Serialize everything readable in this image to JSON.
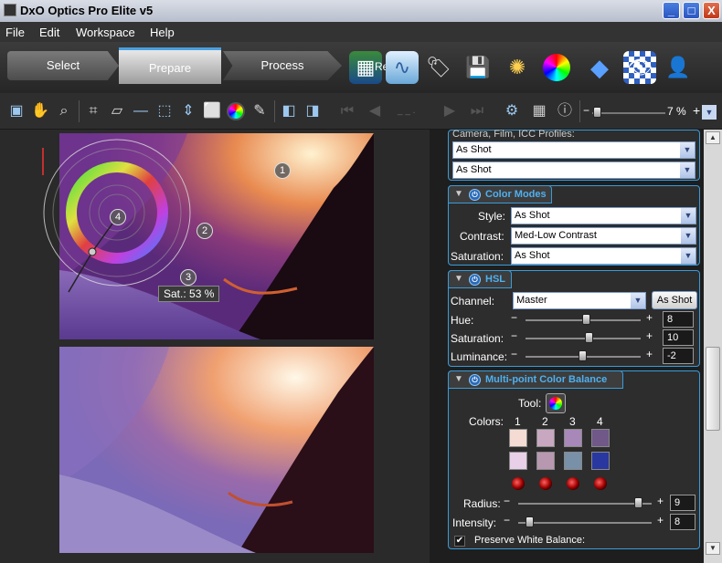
{
  "window": {
    "title": "DxO Optics Pro Elite v5",
    "minimize": "_",
    "maximize": "□",
    "close": "X"
  },
  "menu": [
    "File",
    "Edit",
    "Workspace",
    "Help"
  ],
  "tabs": {
    "select": "Select",
    "prepare": "Prepare",
    "process": "Process",
    "read_frag": "Re"
  },
  "toolbar": {
    "zoom": "7 %",
    "pager": "_ _ ."
  },
  "image": {
    "markers": [
      "1",
      "2",
      "3",
      "4"
    ],
    "sat_readout": "Sat.: 53 %"
  },
  "panel": {
    "profiles_label": "Camera, Film, ICC Profiles:",
    "profiles": [
      "As Shot",
      "As Shot"
    ],
    "color_modes": {
      "title": "Color Modes",
      "style_label": "Style:",
      "style": "As Shot",
      "contrast_label": "Contrast:",
      "contrast": "Med-Low Contrast",
      "saturation_label": "Saturation:",
      "saturation": "As Shot"
    },
    "hsl": {
      "title": "HSL",
      "channel_label": "Channel:",
      "channel": "Master",
      "as_shot_button": "As Shot",
      "rows": [
        {
          "label": "Hue:",
          "value": "8",
          "level": 0.52
        },
        {
          "label": "Saturation:",
          "value": "10",
          "level": 0.55
        },
        {
          "label": "Luminance:",
          "value": "-2",
          "level": 0.49
        }
      ]
    },
    "mpcb": {
      "title": "Multi-point Color Balance",
      "tool_label": "Tool:",
      "colors_label": "Colors:",
      "cols": [
        "1",
        "2",
        "3",
        "4"
      ],
      "swatches_top": [
        "#f4dcd4",
        "#c8a8c0",
        "#a888b8",
        "#705888"
      ],
      "swatches_bot": [
        "#e8d0e8",
        "#b898b0",
        "#7890a8",
        "#2838a0"
      ],
      "radius_label": "Radius:",
      "radius": "9",
      "radius_level": 0.9,
      "intensity_label": "Intensity:",
      "intensity": "8",
      "intensity_level": 0.08,
      "preserve_label": "Preserve White Balance:"
    }
  }
}
